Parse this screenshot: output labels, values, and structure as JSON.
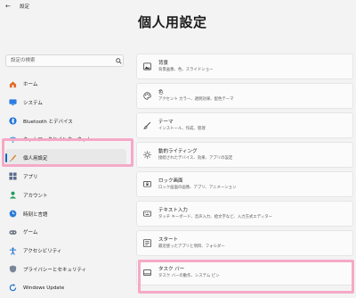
{
  "titlebar": {
    "back_glyph": "←",
    "app_title": "設定"
  },
  "page_title": "個人用設定",
  "search": {
    "placeholder": "設定の検索"
  },
  "sidebar": {
    "items": [
      {
        "label": "ホーム",
        "icon": "home-icon"
      },
      {
        "label": "システム",
        "icon": "monitor-icon"
      },
      {
        "label": "Bluetooth とデバイス",
        "icon": "bluetooth-icon"
      },
      {
        "label": "ネットワークとインターネット",
        "icon": "wifi-icon"
      },
      {
        "label": "個人用設定",
        "icon": "brush-icon",
        "selected": true
      },
      {
        "label": "アプリ",
        "icon": "apps-icon"
      },
      {
        "label": "アカウント",
        "icon": "person-icon"
      },
      {
        "label": "時刻と言語",
        "icon": "globe-clock-icon"
      },
      {
        "label": "ゲーム",
        "icon": "gamepad-icon"
      },
      {
        "label": "アクセシビリティ",
        "icon": "accessibility-icon"
      },
      {
        "label": "プライバシーとセキュリティ",
        "icon": "shield-icon"
      },
      {
        "label": "Windows Update",
        "icon": "update-icon"
      }
    ]
  },
  "cards": [
    {
      "title": "背景",
      "subtitle": "背景画像、色、スライドショー",
      "icon": "image-icon"
    },
    {
      "title": "色",
      "subtitle": "アクセント カラー、透明効果、配色テーマ",
      "icon": "palette-icon"
    },
    {
      "title": "テーマ",
      "subtitle": "インストール、作成、管理",
      "icon": "brush-icon"
    },
    {
      "title": "動的ライティング",
      "subtitle": "接続されたデバイス、効果、アプリの設定",
      "icon": "sun-icon"
    },
    {
      "title": "ロック画面",
      "subtitle": "ロック画面の画像、アプリ、アニメーション",
      "icon": "lockscreen-icon"
    },
    {
      "title": "テキスト入力",
      "subtitle": "タッチ キーボード、音声入力、絵文字など、入力方式エディター",
      "icon": "keyboard-icon"
    },
    {
      "title": "スタート",
      "subtitle": "最近使ったアプリと項目、フォルダー",
      "icon": "start-icon"
    },
    {
      "title": "タスク バー",
      "subtitle": "タスク バーの動作、システム ピン",
      "icon": "taskbar-icon"
    }
  ],
  "colors": {
    "accent": "#0067c0",
    "highlight": "#f6a9c7",
    "background": "#f3f3f3",
    "card": "#fbfbfb"
  }
}
